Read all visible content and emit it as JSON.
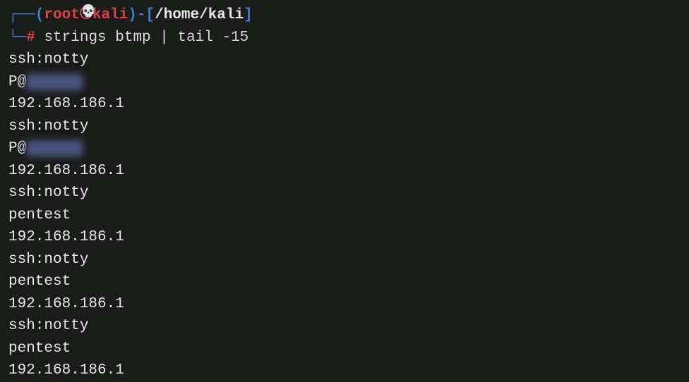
{
  "prompt": {
    "box_top": "┌──",
    "box_bottom": "└─",
    "paren_open": "(",
    "user": "root",
    "skull": "💀",
    "host": "kali",
    "paren_close": ")",
    "dash": "-",
    "bracket_open": "[",
    "path": "/home/kali",
    "bracket_close": "]",
    "hash": "#",
    "command": "strings btmp | tail -15"
  },
  "output": [
    {
      "text": "ssh:notty",
      "blurred": false
    },
    {
      "text": "P@",
      "blurred": true,
      "blurred_part": "ssword"
    },
    {
      "text": "192.168.186.1",
      "blurred": false
    },
    {
      "text": "ssh:notty",
      "blurred": false
    },
    {
      "text": "P@",
      "blurred": true,
      "blurred_part": "ssword"
    },
    {
      "text": "192.168.186.1",
      "blurred": false
    },
    {
      "text": "ssh:notty",
      "blurred": false
    },
    {
      "text": "pentest",
      "blurred": false
    },
    {
      "text": "192.168.186.1",
      "blurred": false
    },
    {
      "text": "ssh:notty",
      "blurred": false
    },
    {
      "text": "pentest",
      "blurred": false
    },
    {
      "text": "192.168.186.1",
      "blurred": false
    },
    {
      "text": "ssh:notty",
      "blurred": false
    },
    {
      "text": "pentest",
      "blurred": false
    },
    {
      "text": "192.168.186.1",
      "blurred": false
    }
  ]
}
